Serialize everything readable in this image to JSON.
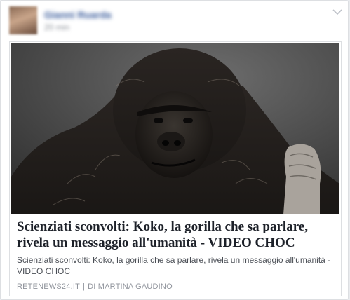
{
  "post": {
    "author_name": "Gianni Ruarda",
    "timestamp": "20 min",
    "menu_icon": "chevron-down-icon"
  },
  "link_preview": {
    "image_subject": "gorilla",
    "headline": "Scienziati sconvolti: Koko, la gorilla che sa parlare, rivela un messaggio all'umanità - VIDEO CHOC",
    "description": "Scienziati sconvolti: Koko, la gorilla che sa parlare, rivela un messaggio all'umanità - VIDEO CHOC",
    "domain": "RETENEWS24.IT",
    "separator": "|",
    "byline": "DI MARTINA GAUDINO"
  }
}
